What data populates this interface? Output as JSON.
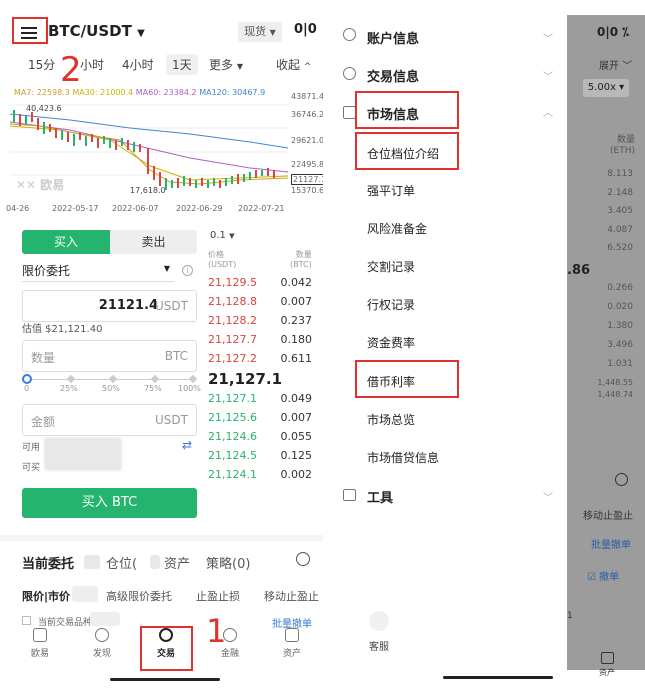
{
  "left": {
    "pair": "BTC/USDT",
    "spot_badge": "现货",
    "timeframes": [
      "15分",
      "小时",
      "4小时",
      "1天",
      "更多",
      "收起"
    ],
    "ma_line": {
      "ma7": "MA7: 22598.3",
      "ma30": "MA30: 21000.4",
      "ma60": "MA60: 23384.2",
      "ma120": "MA120: 30467.9"
    },
    "price_axis": [
      "43871.4",
      "36746.2",
      "29621.0",
      "22495.8",
      "21127.1",
      "15370.6"
    ],
    "chart_labels": {
      "high": "40,423.6",
      "low": "17,618.0",
      "watermark": "欧易"
    },
    "date_axis": [
      "04-26",
      "2022-05-17",
      "2022-06-07",
      "2022-06-29",
      "2022-07-21"
    ],
    "buy_tab": "买入",
    "sell_tab": "卖出",
    "order_type": "限价委托",
    "price_input": {
      "value": "21121.4",
      "unit": "USDT"
    },
    "estimate": "估值 $21,121.40",
    "qty_input": {
      "placeholder": "数量",
      "unit": "BTC"
    },
    "slider_marks": [
      "0",
      "25%",
      "50%",
      "75%",
      "100%"
    ],
    "amount_input": {
      "placeholder": "金额",
      "unit": "USDT"
    },
    "available_label": "可用",
    "can_buy_label": "可买",
    "buy_button": "买入 BTC",
    "book": {
      "depth": "0.1",
      "price_header": "价格",
      "price_unit": "(USDT)",
      "qty_header": "数量",
      "qty_unit": "(BTC)",
      "asks": [
        {
          "price": "21,129.5",
          "qty": "0.042"
        },
        {
          "price": "21,128.8",
          "qty": "0.007"
        },
        {
          "price": "21,128.2",
          "qty": "0.237"
        },
        {
          "price": "21,127.7",
          "qty": "0.180"
        },
        {
          "price": "21,127.2",
          "qty": "0.611"
        }
      ],
      "last_price": "21,127.1",
      "bids": [
        {
          "price": "21,127.1",
          "qty": "0.049"
        },
        {
          "price": "21,125.6",
          "qty": "0.007"
        },
        {
          "price": "21,124.6",
          "qty": "0.055"
        },
        {
          "price": "21,124.5",
          "qty": "0.125"
        },
        {
          "price": "21,124.1",
          "qty": "0.002"
        }
      ]
    },
    "bottom_tabs": [
      "当前委托",
      "仓位(",
      "资产",
      "策略(0)"
    ],
    "sub_tabs": [
      "限价|市价",
      "高级限价委托",
      "止盈止损",
      "移动止盈止"
    ],
    "current_only": "当前交易品种",
    "batch_cancel": "批量撤单",
    "nav": [
      "欧易",
      "发现",
      "交易",
      "金融",
      "资产"
    ],
    "annotation_1": "1",
    "annotation_2": "2"
  },
  "right": {
    "sections": [
      {
        "label": "账户信息"
      },
      {
        "label": "交易信息"
      },
      {
        "label": "市场信息"
      },
      {
        "label": "工具"
      }
    ],
    "market_items": [
      "仓位档位介绍",
      "强平订单",
      "风险准备金",
      "交割记录",
      "行权记录",
      "资金费率",
      "借币利率",
      "市场总览",
      "市场借贷信息"
    ],
    "service": "客服",
    "dim": {
      "expand": "展开",
      "leverage": "5.00x",
      "qty_header": "数量",
      "qty_unit": "(ETH)",
      "values_top": [
        "8.113",
        "2.148",
        "3.405",
        "4.087",
        "6.520"
      ],
      "price_fragment": ".86",
      "values_bottom": [
        "0.266",
        "0.020",
        "1.380",
        "3.496",
        "1.031",
        "1,448.55",
        "1,448.74"
      ],
      "trailing": "移动止盈止",
      "batch_cancel": "批量撤单",
      "cancel": "撤单",
      "assets": "资产",
      "one": "1"
    }
  },
  "colors": {
    "buy_green": "#25b46d",
    "sell_red": "#d9453f",
    "annotation_red": "#e0312b"
  }
}
